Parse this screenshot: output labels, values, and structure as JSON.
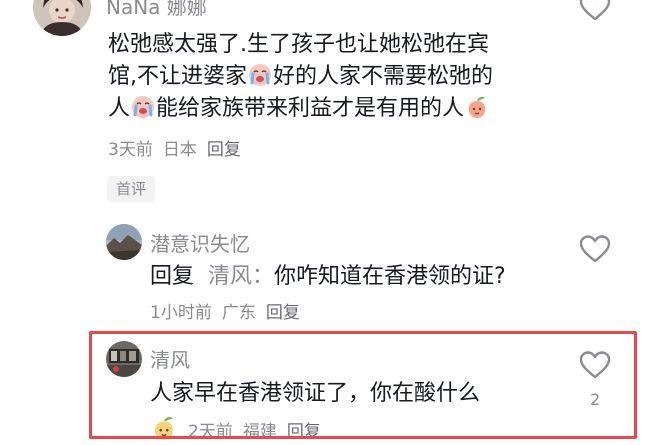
{
  "comment1": {
    "username": "NaNa 娜娜",
    "line1": "松弛感太强了.生了孩子也让她松弛在宾",
    "line2a": "馆,不让进婆家",
    "line2b": "好的人家不需要松弛的",
    "line3a": "人",
    "line3b": "能给家族带来利益才是有用的人",
    "time": "3天前",
    "location": "日本",
    "reply_label": "回复",
    "tag": "首评"
  },
  "reply1": {
    "username": "潜意识失忆",
    "reply_prefix": "回复",
    "target": "清风：",
    "content": "你咋知道在香港领的证?",
    "time": "1小时前",
    "location": "广东",
    "reply_label": "回复"
  },
  "reply2": {
    "username": "清风",
    "content": "人家早在香港领证了，你在酸什么",
    "time": "2天前",
    "location": "福建",
    "reply_label": "回复",
    "like_count": "2"
  },
  "colors": {
    "highlight_border": "#e8484b",
    "muted_text": "#8a8b91"
  },
  "icons": {
    "like": "heart-outline-icon",
    "cry": "crying-face-emoji",
    "peach": "peach-emoji"
  }
}
